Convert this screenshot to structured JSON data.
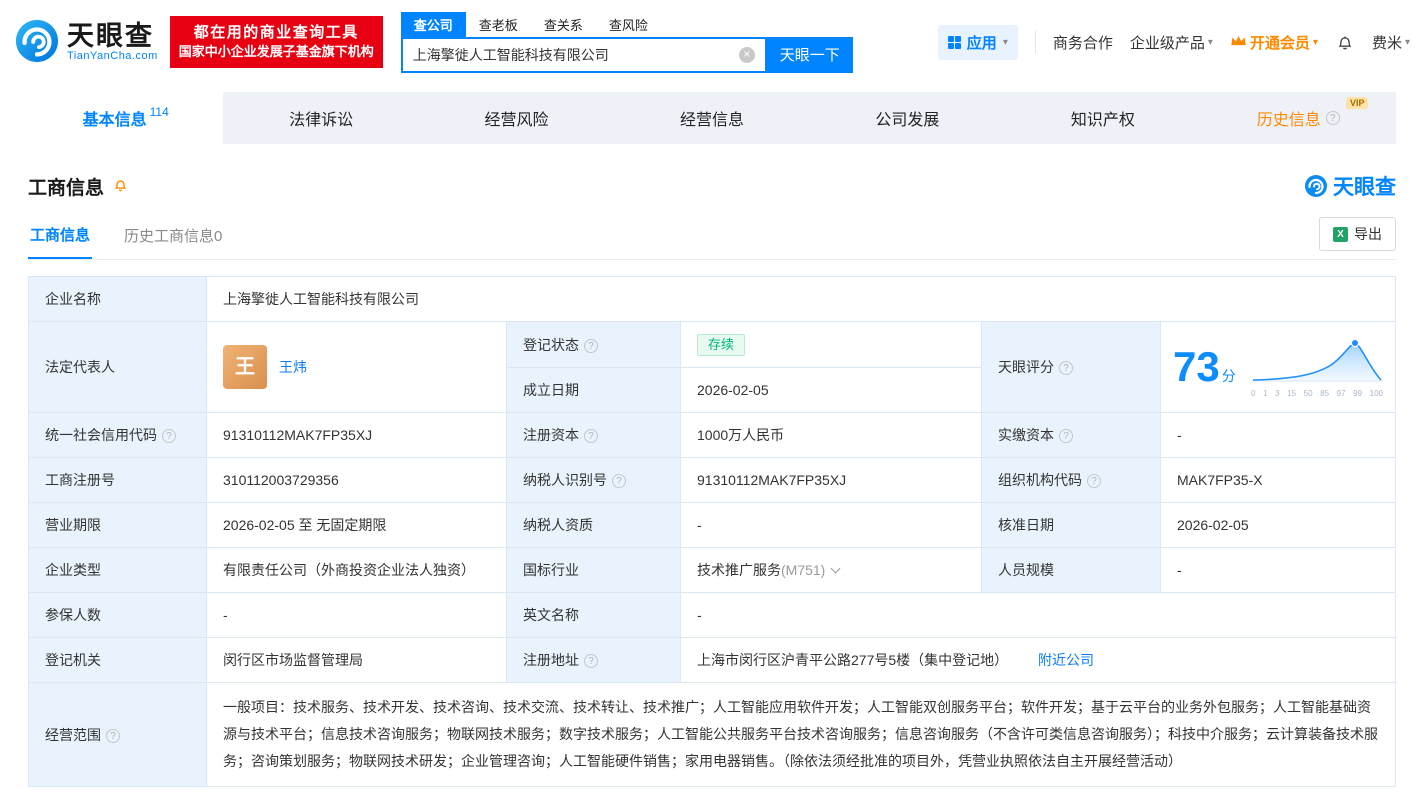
{
  "brand": {
    "name": "天眼查",
    "domain": "TianYanCha.com"
  },
  "colors": {
    "accent": "#0084ff",
    "banner_red": "#e60012",
    "vip_orange": "#ff8a00",
    "status_green": "#00b578",
    "label_bg": "#e9f3fd"
  },
  "icons": {
    "caret": "▾",
    "close": "×",
    "help": "?",
    "excel": "X"
  },
  "header": {
    "banner_line1": "都在用的商业查询工具",
    "banner_line2": "国家中小企业发展子基金旗下机构",
    "search_tabs": [
      "查公司",
      "查老板",
      "查关系",
      "查风险"
    ],
    "search_value": "上海擎徙人工智能科技有限公司",
    "search_button": "天眼一下",
    "apps_label": "应用",
    "coop_label": "商务合作",
    "enterprise_label": "企业级产品",
    "vip_label": "开通会员",
    "user_label": "费米"
  },
  "nav": {
    "tabs": [
      {
        "label": "基本信息",
        "count": "114"
      },
      {
        "label": "法律诉讼"
      },
      {
        "label": "经营风险"
      },
      {
        "label": "经营信息"
      },
      {
        "label": "公司发展"
      },
      {
        "label": "知识产权"
      },
      {
        "label": "历史信息",
        "vip": "VIP"
      }
    ]
  },
  "section": {
    "title": "工商信息",
    "tab_active": "工商信息",
    "tab_history": "历史工商信息0",
    "export_label": "导出"
  },
  "table": {
    "labels": {
      "company_name": "企业名称",
      "legal_rep": "法定代表人",
      "reg_status": "登记状态",
      "est_date": "成立日期",
      "score": "天眼评分",
      "credit_code": "统一社会信用代码",
      "reg_capital": "注册资本",
      "paid_capital": "实缴资本",
      "reg_number": "工商注册号",
      "taxpayer_id": "纳税人识别号",
      "org_code": "组织机构代码",
      "business_term": "营业期限",
      "taxpayer_quality": "纳税人资质",
      "approval_date": "核准日期",
      "company_type": "企业类型",
      "industry": "国标行业",
      "staff_size": "人员规模",
      "insured_count": "参保人数",
      "english_name": "英文名称",
      "reg_authority": "登记机关",
      "reg_address": "注册地址",
      "business_scope": "经营范围"
    },
    "values": {
      "company_name": "上海擎徙人工智能科技有限公司",
      "legal_rep_avatar": "王",
      "legal_rep": "王炜",
      "reg_status": "存续",
      "est_date": "2026-02-05",
      "score_value": "73",
      "score_unit": "分",
      "score_axis": [
        "0",
        "1",
        "3",
        "15",
        "50",
        "85",
        "97",
        "99",
        "100"
      ],
      "credit_code": "91310112MAK7FP35XJ",
      "reg_capital": "1000万人民币",
      "paid_capital": "-",
      "reg_number": "310112003729356",
      "taxpayer_id": "91310112MAK7FP35XJ",
      "org_code": "MAK7FP35-X",
      "business_term": "2026-02-05 至 无固定期限",
      "taxpayer_quality": "-",
      "approval_date": "2026-02-05",
      "company_type": "有限责任公司（外商投资企业法人独资）",
      "industry": "技术推广服务",
      "industry_code": "(M751)",
      "staff_size": "-",
      "insured_count": "-",
      "english_name": "-",
      "reg_authority": "闵行区市场监督管理局",
      "reg_address": "上海市闵行区沪青平公路277号5楼（集中登记地）",
      "nearby_link": "附近公司",
      "business_scope": "一般项目：技术服务、技术开发、技术咨询、技术交流、技术转让、技术推广；人工智能应用软件开发；人工智能双创服务平台；软件开发；基于云平台的业务外包服务；人工智能基础资源与技术平台；信息技术咨询服务；物联网技术服务；数字技术服务；人工智能公共服务平台技术咨询服务；信息咨询服务（不含许可类信息咨询服务）；科技中介服务；云计算装备技术服务；咨询策划服务；物联网技术研发；企业管理咨询；人工智能硬件销售；家用电器销售。（除依法须经批准的项目外，凭营业执照依法自主开展经营活动）"
    }
  }
}
